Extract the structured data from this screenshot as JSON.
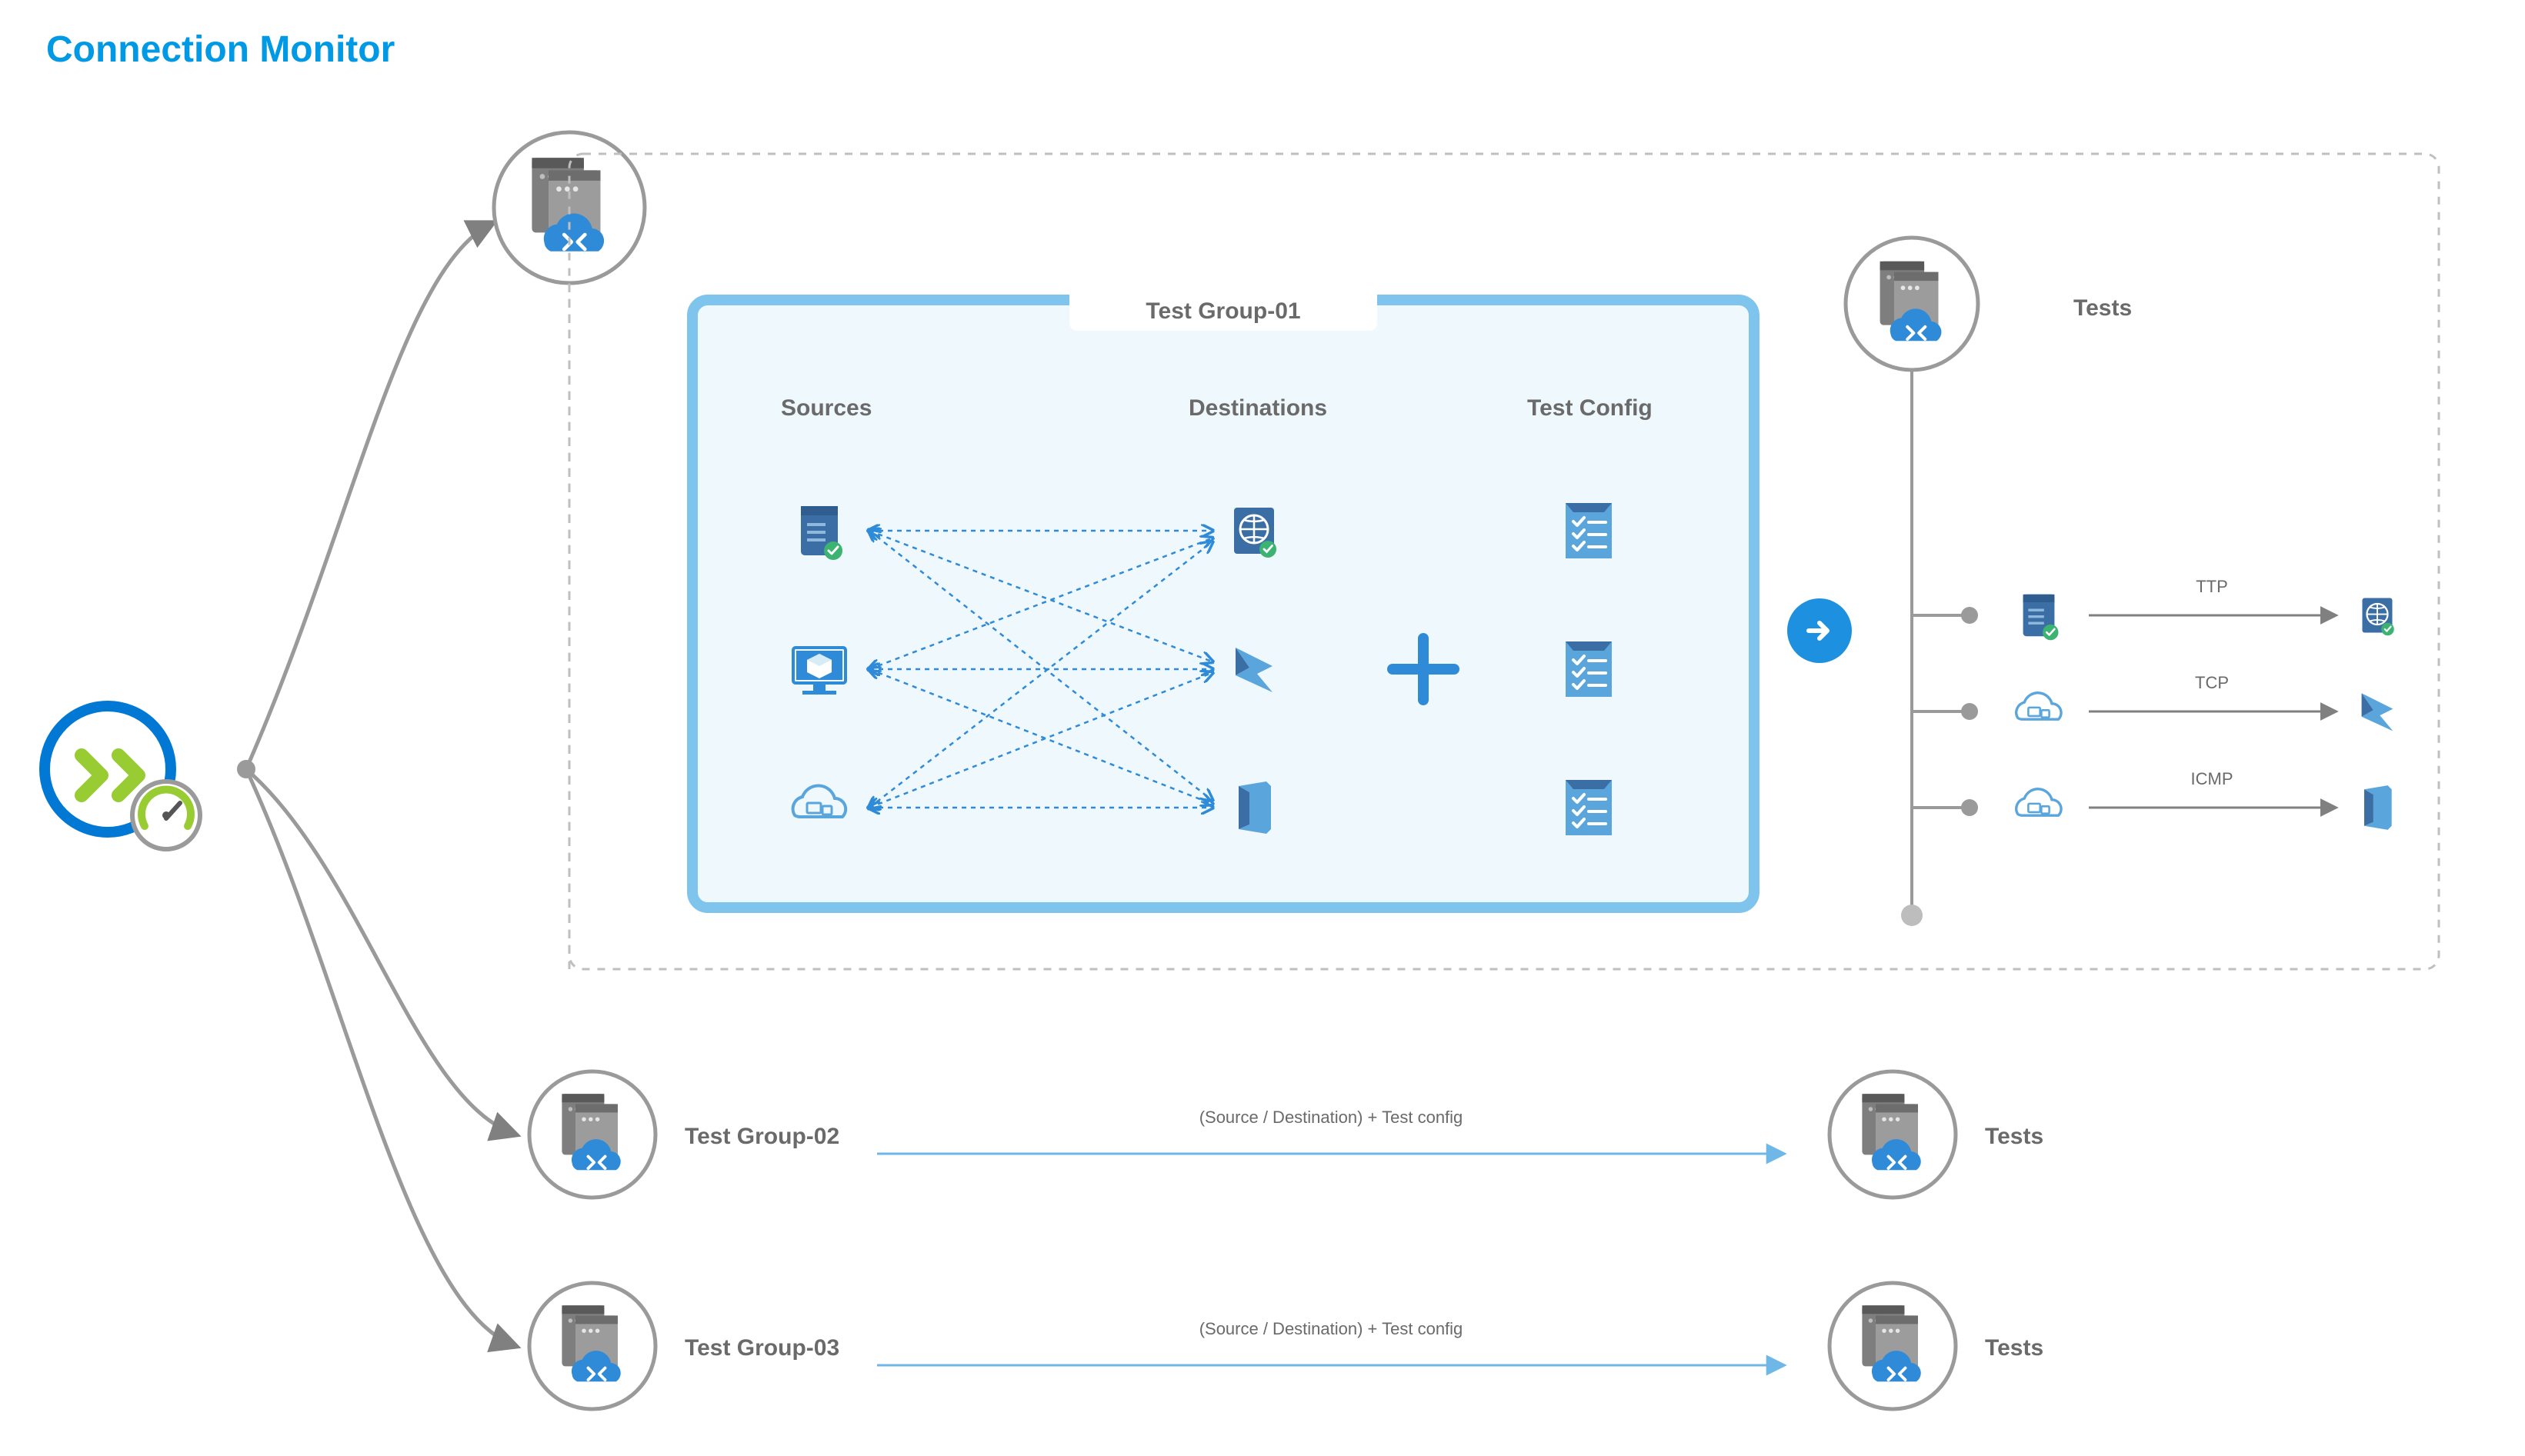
{
  "title": "Connection Monitor",
  "testGroup1": {
    "title": "Test Group-01",
    "sourcesHdr": "Sources",
    "destHdr": "Destinations",
    "configHdr": "Test Config"
  },
  "testsHdr": "Tests",
  "tests": {
    "t1": "TTP",
    "t2": "TCP",
    "t3": "ICMP"
  },
  "row2": {
    "label": "Test Group-02",
    "caption": "(Source / Destination) + Test config",
    "tests": "Tests"
  },
  "row3": {
    "label": "Test Group-03",
    "caption": "(Source / Destination) + Test config",
    "tests": "Tests"
  },
  "colors": {
    "brandBlue": "#0099e5",
    "iconBlue": "#2f8bd8",
    "iconDark": "#3a6ea5",
    "accentGreen": "#99cc33",
    "grey": "#808080",
    "lightGrey": "#bfbfbf",
    "paleBlue": "#d6edf8",
    "vPaleBlue": "#eef8fd",
    "headerBlue": "#6fb7e6"
  }
}
